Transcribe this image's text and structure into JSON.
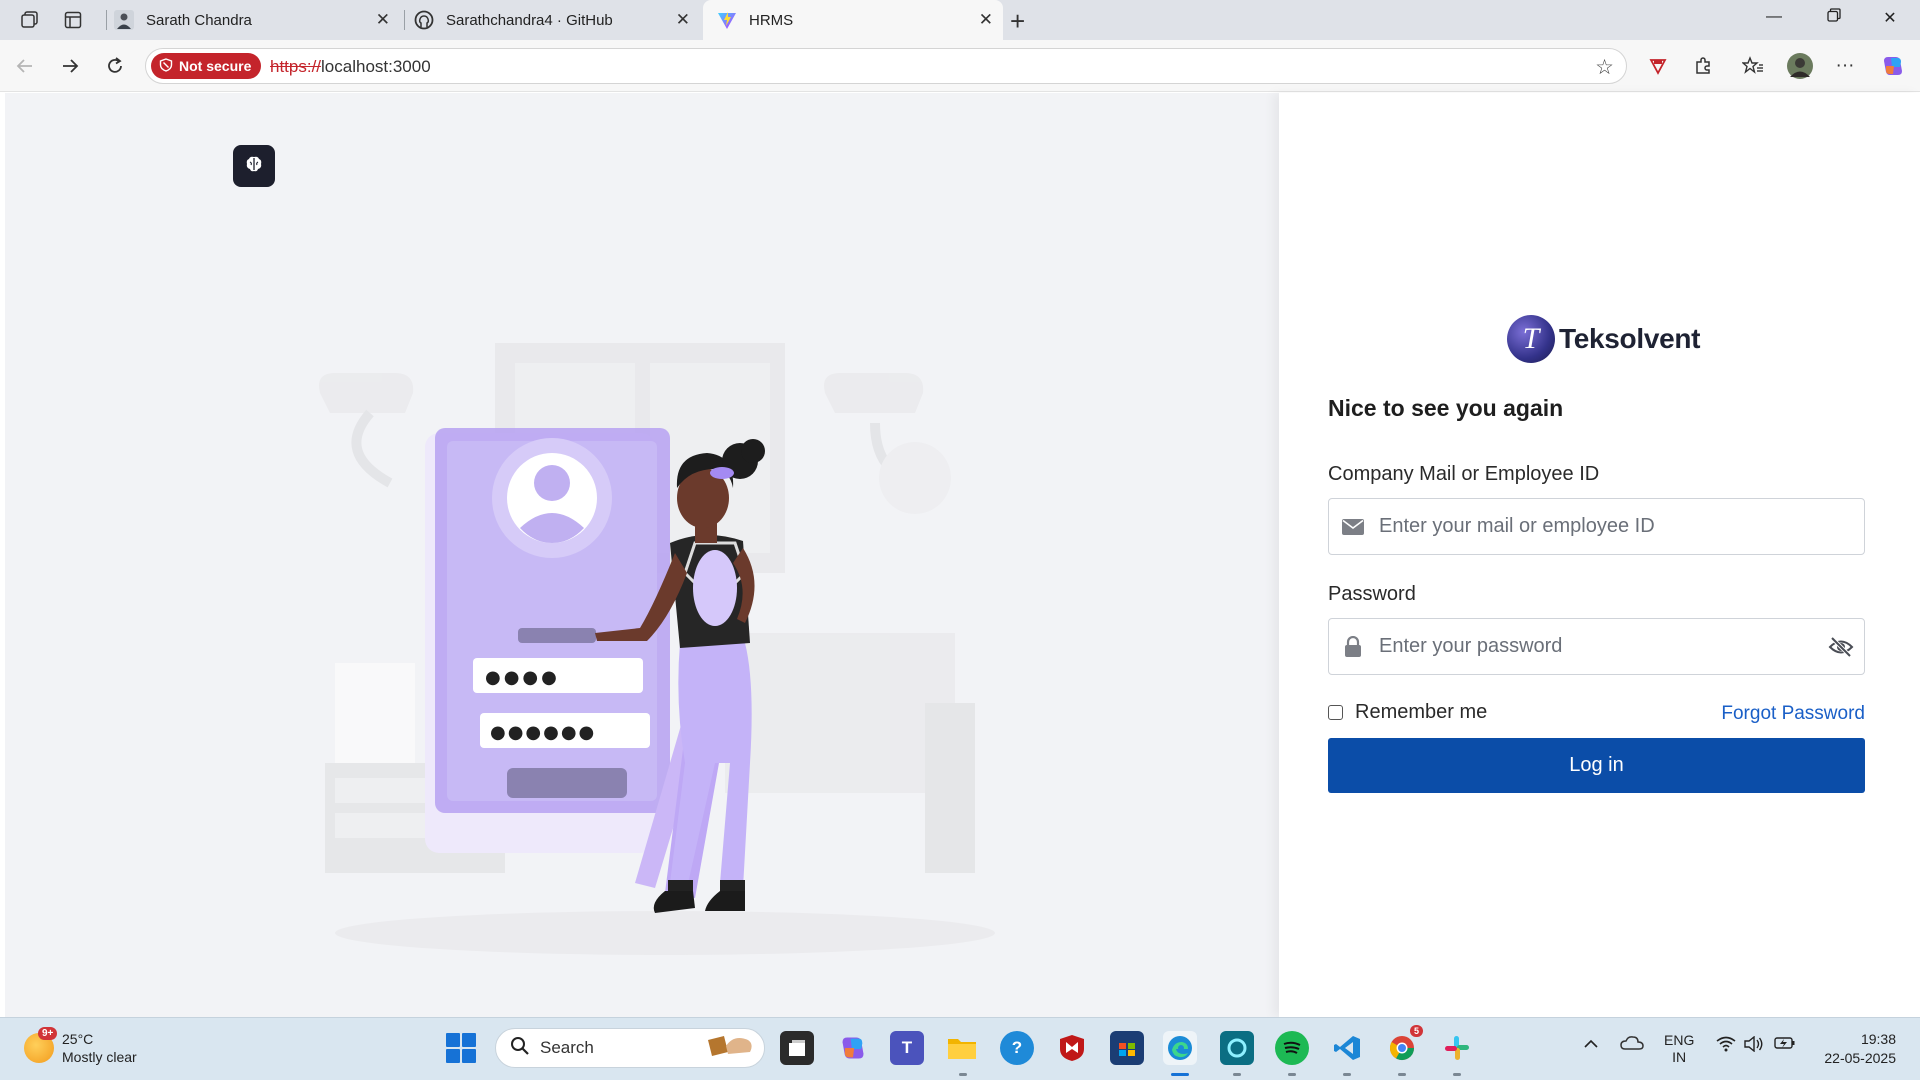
{
  "browser": {
    "tabs": [
      {
        "title": "Sarath Chandra",
        "favicon": "profile-photo",
        "active": false
      },
      {
        "title": "Sarathchandra4 · GitHub",
        "favicon": "github-icon",
        "active": false
      },
      {
        "title": "HRMS",
        "favicon": "vite-icon",
        "active": true
      }
    ],
    "security_label": "Not secure",
    "url_scheme": "https://",
    "url_host": "localhost:3000"
  },
  "login": {
    "brand_name": "Teksolvent",
    "brand_logo_letter": "T",
    "heading": "Nice to see you again",
    "email_label": "Company Mail or Employee ID",
    "email_placeholder": "Enter your mail or employee ID",
    "email_value": "",
    "password_label": "Password",
    "password_placeholder": "Enter your password",
    "password_value": "",
    "remember_label": "Remember me",
    "remember_checked": false,
    "forgot_label": "Forgot Password",
    "login_button": "Log in",
    "accent_color": "#0b4da8",
    "illustration": {
      "pin_dots": "●●●●",
      "password_dots": "●●●●●●"
    }
  },
  "taskbar": {
    "weather_temp": "25°C",
    "weather_desc": "Mostly clear",
    "weather_badge": "9+",
    "search_label": "Search",
    "chrome_badge": "5",
    "language_line1": "ENG",
    "language_line2": "IN",
    "time": "19:38",
    "date": "22-05-2025"
  }
}
